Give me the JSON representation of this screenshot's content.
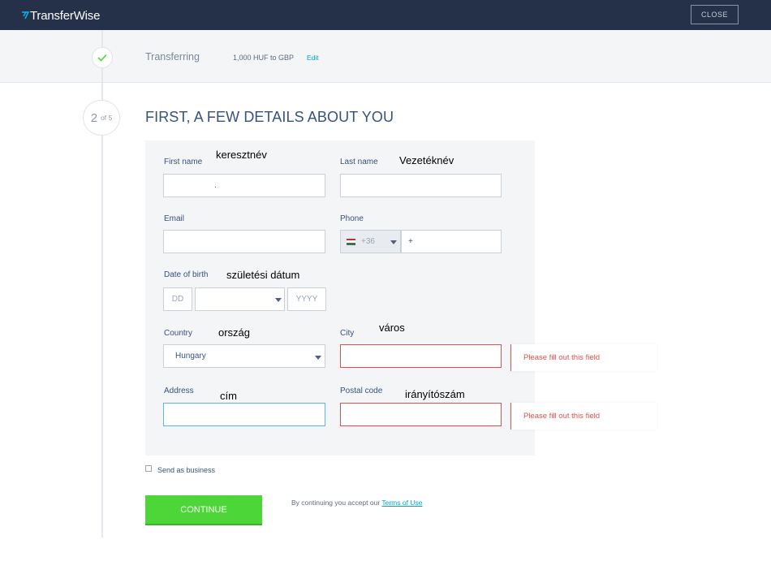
{
  "header": {
    "logo_text": "TransferWise",
    "logo_icon": "transferwise-flag-icon",
    "close_label": "CLOSE"
  },
  "summary": {
    "step_title": "Transferring",
    "detail": "1,000 HUF to GBP",
    "edit_label": "Edit",
    "status_icon": "checkmark-icon"
  },
  "step": {
    "number": "2",
    "of_label": "of 5",
    "heading": "FIRST, A FEW DETAILS ABOUT YOU"
  },
  "form": {
    "first_name": {
      "label": "First name",
      "annotation": "keresztnév",
      "value": "."
    },
    "last_name": {
      "label": "Last name",
      "annotation": "Vezetéknév",
      "value": ""
    },
    "email": {
      "label": "Email",
      "value": ""
    },
    "phone": {
      "label": "Phone",
      "country_code": "+36",
      "flag": "hungary-flag-icon",
      "value": "+"
    },
    "dob": {
      "label": "Date of birth",
      "annotation": "születési dátum",
      "day_placeholder": "DD",
      "month_value": "",
      "year_placeholder": "YYYY"
    },
    "country": {
      "label": "Country",
      "annotation": "ország",
      "value": "Hungary"
    },
    "city": {
      "label": "City",
      "annotation": "város",
      "value": "",
      "error": "Please fill out this field"
    },
    "address": {
      "label": "Address",
      "annotation": "cím",
      "value": ""
    },
    "postal_code": {
      "label": "Postal code",
      "annotation": "irányítószám",
      "value": "",
      "error": "Please fill out this field"
    }
  },
  "send_as_business": {
    "label": "Send as business",
    "checked": false
  },
  "continue_label": "CONTINUE",
  "terms": {
    "prefix": "By continuing you accept our",
    "link": "Terms of Use"
  },
  "colors": {
    "topbar": "#253149",
    "accent_blue": "#00a2dd",
    "continue_green": "#4cd637",
    "error_red": "#d9534f",
    "text_navy": "#37517e"
  }
}
